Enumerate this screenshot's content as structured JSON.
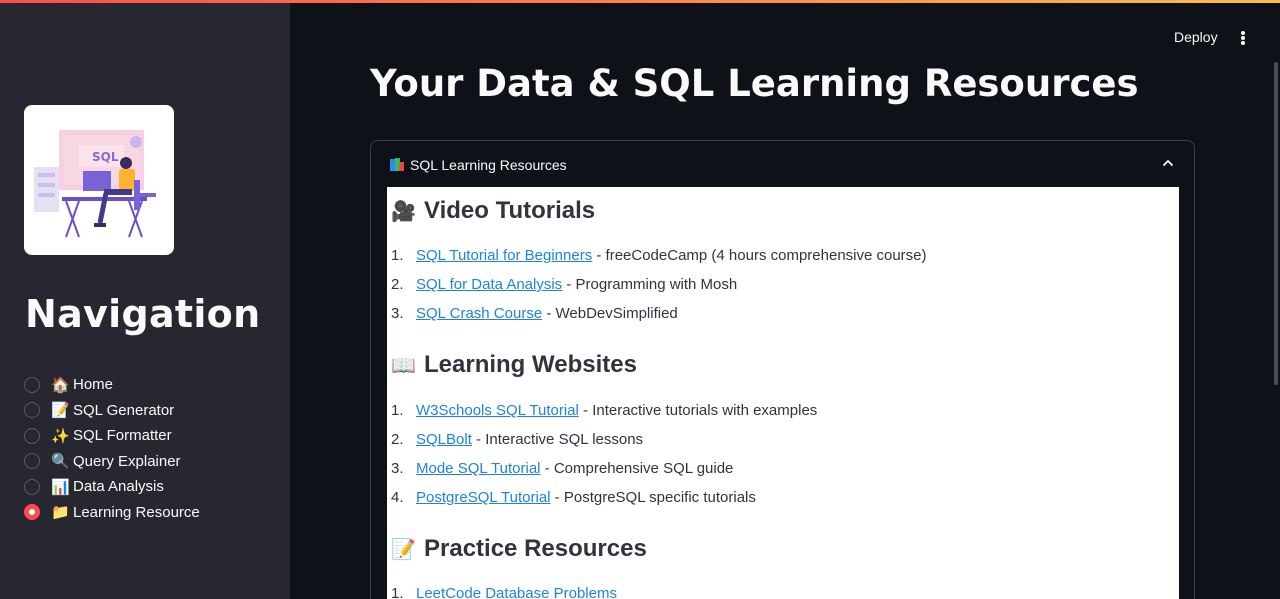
{
  "sidebar": {
    "title": "Navigation",
    "logo_text": "SQL",
    "items": [
      {
        "emoji": "🏠",
        "label": "Home",
        "selected": false
      },
      {
        "emoji": "📝",
        "label": "SQL Generator",
        "selected": false
      },
      {
        "emoji": "✨",
        "label": "SQL Formatter",
        "selected": false
      },
      {
        "emoji": "🔍",
        "label": "Query Explainer",
        "selected": false
      },
      {
        "emoji": "📊",
        "label": "Data Analysis",
        "selected": false
      },
      {
        "emoji": "📁",
        "label": "Learning Resource",
        "selected": true
      }
    ]
  },
  "header": {
    "deploy_label": "Deploy"
  },
  "main": {
    "title": "Your Data & SQL Learning Resources",
    "expander": {
      "label": "SQL Learning Resources",
      "sections": [
        {
          "emoji": "🎥",
          "heading": "Video Tutorials",
          "items": [
            {
              "num": "1.",
              "link": "SQL Tutorial for Beginners",
              "desc": " - freeCodeCamp (4 hours comprehensive course)"
            },
            {
              "num": "2.",
              "link": "SQL for Data Analysis",
              "desc": " - Programming with Mosh"
            },
            {
              "num": "3.",
              "link": "SQL Crash Course",
              "desc": " - WebDevSimplified"
            }
          ]
        },
        {
          "emoji": "📖",
          "heading": "Learning Websites",
          "items": [
            {
              "num": "1.",
              "link": "W3Schools SQL Tutorial",
              "desc": " - Interactive tutorials with examples"
            },
            {
              "num": "2.",
              "link": "SQLBolt",
              "desc": " - Interactive SQL lessons"
            },
            {
              "num": "3.",
              "link": "Mode SQL Tutorial",
              "desc": " - Comprehensive SQL guide"
            },
            {
              "num": "4.",
              "link": "PostgreSQL Tutorial",
              "desc": " - PostgreSQL specific tutorials"
            }
          ]
        },
        {
          "emoji": "📝",
          "heading": "Practice Resources",
          "items": [
            {
              "num": "1.",
              "link": "LeetCode Database Problems",
              "desc": ""
            }
          ]
        }
      ]
    }
  },
  "colors": {
    "accent": "#ff4b4b",
    "link": "#1c83e1",
    "sidebar_bg": "#262730",
    "main_bg": "#0e1117"
  }
}
